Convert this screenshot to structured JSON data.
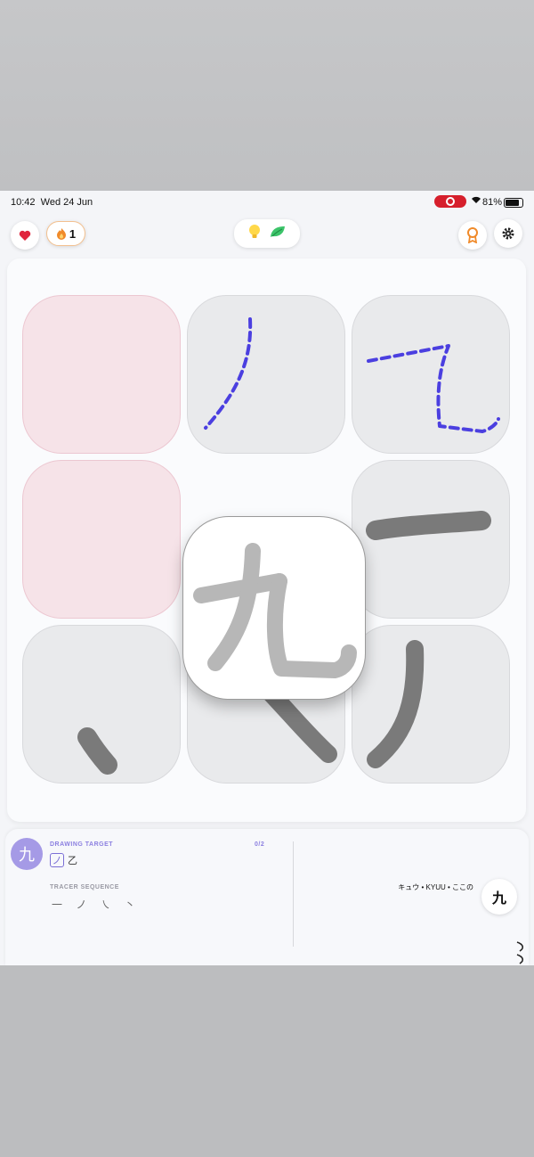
{
  "status_bar": {
    "time": "10:42",
    "date": "Wed 24 Jun",
    "battery": "81%"
  },
  "top_bar": {
    "streak_count": "1"
  },
  "board": {
    "tiles": [
      {
        "state": "empty-pink"
      },
      {
        "state": "traced",
        "stroke": "ノ"
      },
      {
        "state": "traced",
        "stroke": "乙"
      },
      {
        "state": "empty-pink"
      },
      {
        "state": "target",
        "character": "九"
      },
      {
        "state": "option",
        "stroke": "一"
      },
      {
        "state": "option",
        "stroke": "丶"
      },
      {
        "state": "option",
        "stroke": "㇏"
      },
      {
        "state": "option",
        "stroke": "ノ"
      }
    ]
  },
  "panel": {
    "kanji": "九",
    "drawing_target_label": "DRAWING TARGET",
    "progress": "0/2",
    "target_strokes": [
      "ノ",
      "乙"
    ],
    "tracer_sequence_label": "TRACER SEQUENCE",
    "tracer_sequence": "一 ノ ㇏ 丶",
    "reading": "キュウ • KYUU • ここの",
    "kanji_button": "九"
  },
  "colors": {
    "accent": "#7b6fd6",
    "dash": "#4b3fe0",
    "heart": "#e0263e",
    "flame": "#f08a2a"
  }
}
